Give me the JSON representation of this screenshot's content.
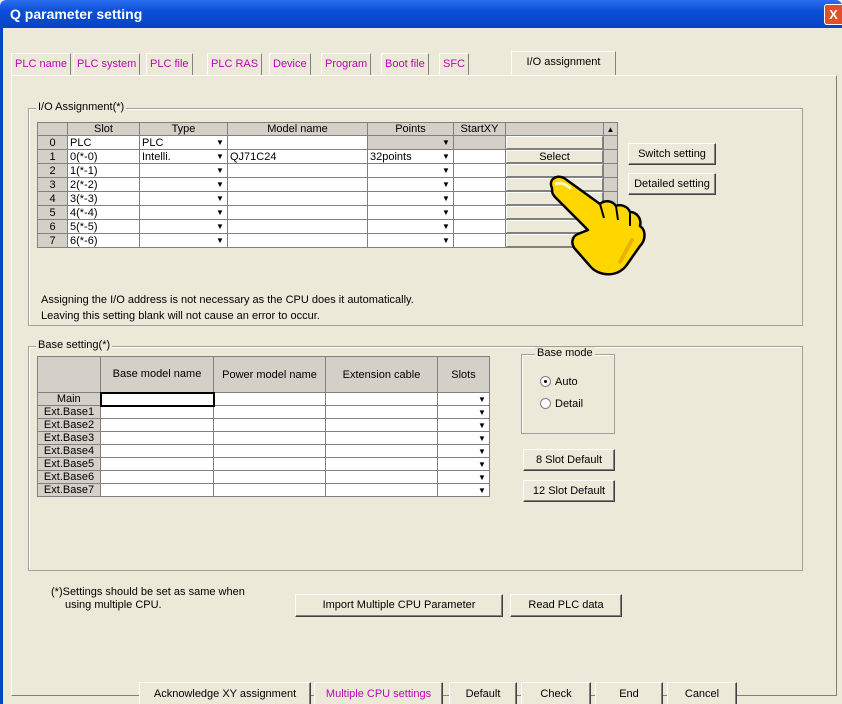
{
  "window": {
    "title": "Q parameter setting",
    "close_glyph": "X"
  },
  "tabs": [
    {
      "label": "PLC name"
    },
    {
      "label": "PLC system"
    },
    {
      "label": "PLC file"
    },
    {
      "label": "PLC RAS"
    },
    {
      "label": "Device"
    },
    {
      "label": "Program"
    },
    {
      "label": "Boot file"
    },
    {
      "label": "SFC"
    },
    {
      "label": "I/O assignment",
      "active": true
    }
  ],
  "io_assignment": {
    "group_label": "I/O Assignment(*)",
    "headers": {
      "slot": "Slot",
      "type": "Type",
      "model": "Model name",
      "points": "Points",
      "startxy": "StartXY"
    },
    "rows": [
      {
        "num": "0",
        "slot": "PLC",
        "type": "PLC",
        "model": "",
        "points": "",
        "startxy": ""
      },
      {
        "num": "1",
        "slot": "0(*-0)",
        "type": "Intelli.",
        "model": "QJ71C24",
        "points": "32points",
        "startxy": "",
        "button": "Select"
      },
      {
        "num": "2",
        "slot": "1(*-1)",
        "type": "",
        "model": "",
        "points": "",
        "startxy": ""
      },
      {
        "num": "3",
        "slot": "2(*-2)",
        "type": "",
        "model": "",
        "points": "",
        "startxy": ""
      },
      {
        "num": "4",
        "slot": "3(*-3)",
        "type": "",
        "model": "",
        "points": "",
        "startxy": ""
      },
      {
        "num": "5",
        "slot": "4(*-4)",
        "type": "",
        "model": "",
        "points": "",
        "startxy": ""
      },
      {
        "num": "6",
        "slot": "5(*-5)",
        "type": "",
        "model": "",
        "points": "",
        "startxy": ""
      },
      {
        "num": "7",
        "slot": "6(*-6)",
        "type": "",
        "model": "",
        "points": "",
        "startxy": ""
      }
    ],
    "note_line1": "Assigning the I/O address is not necessary as the CPU does it automatically.",
    "note_line2": "Leaving this setting blank will not cause an error to occur.",
    "switch_setting": "Switch setting",
    "detailed_setting": "Detailed setting"
  },
  "base_setting": {
    "group_label": "Base setting(*)",
    "headers": {
      "base_model": "Base model name",
      "power_model": "Power model name",
      "ext_cable": "Extension cable",
      "slots": "Slots"
    },
    "rows": [
      {
        "label": "Main"
      },
      {
        "label": "Ext.Base1"
      },
      {
        "label": "Ext.Base2"
      },
      {
        "label": "Ext.Base3"
      },
      {
        "label": "Ext.Base4"
      },
      {
        "label": "Ext.Base5"
      },
      {
        "label": "Ext.Base6"
      },
      {
        "label": "Ext.Base7"
      }
    ],
    "base_mode": {
      "label": "Base mode",
      "auto": "Auto",
      "detail": "Detail",
      "selected": "Auto"
    },
    "slot8_default": "8 Slot Default",
    "slot12_default": "12 Slot Default"
  },
  "footer_note": {
    "line1": "(*)Settings should be set as same when",
    "line2": "using multiple CPU."
  },
  "buttons": {
    "import_multiple_cpu": "Import Multiple CPU Parameter",
    "read_plc_data": "Read PLC data",
    "acknowledge_xy": "Acknowledge XY assignment",
    "multiple_cpu_settings": "Multiple CPU settings",
    "default": "Default",
    "check": "Check",
    "end": "End",
    "cancel": "Cancel"
  },
  "colors": {
    "titlebar": "#0a4fd6",
    "tab_text": "#c000c0",
    "dialog_bg": "#ece9d8",
    "hand": "#ffd700"
  },
  "icons": {
    "pointer": "pointing-hand-icon",
    "dropdown": "chevron-down-icon",
    "close": "close-icon"
  }
}
